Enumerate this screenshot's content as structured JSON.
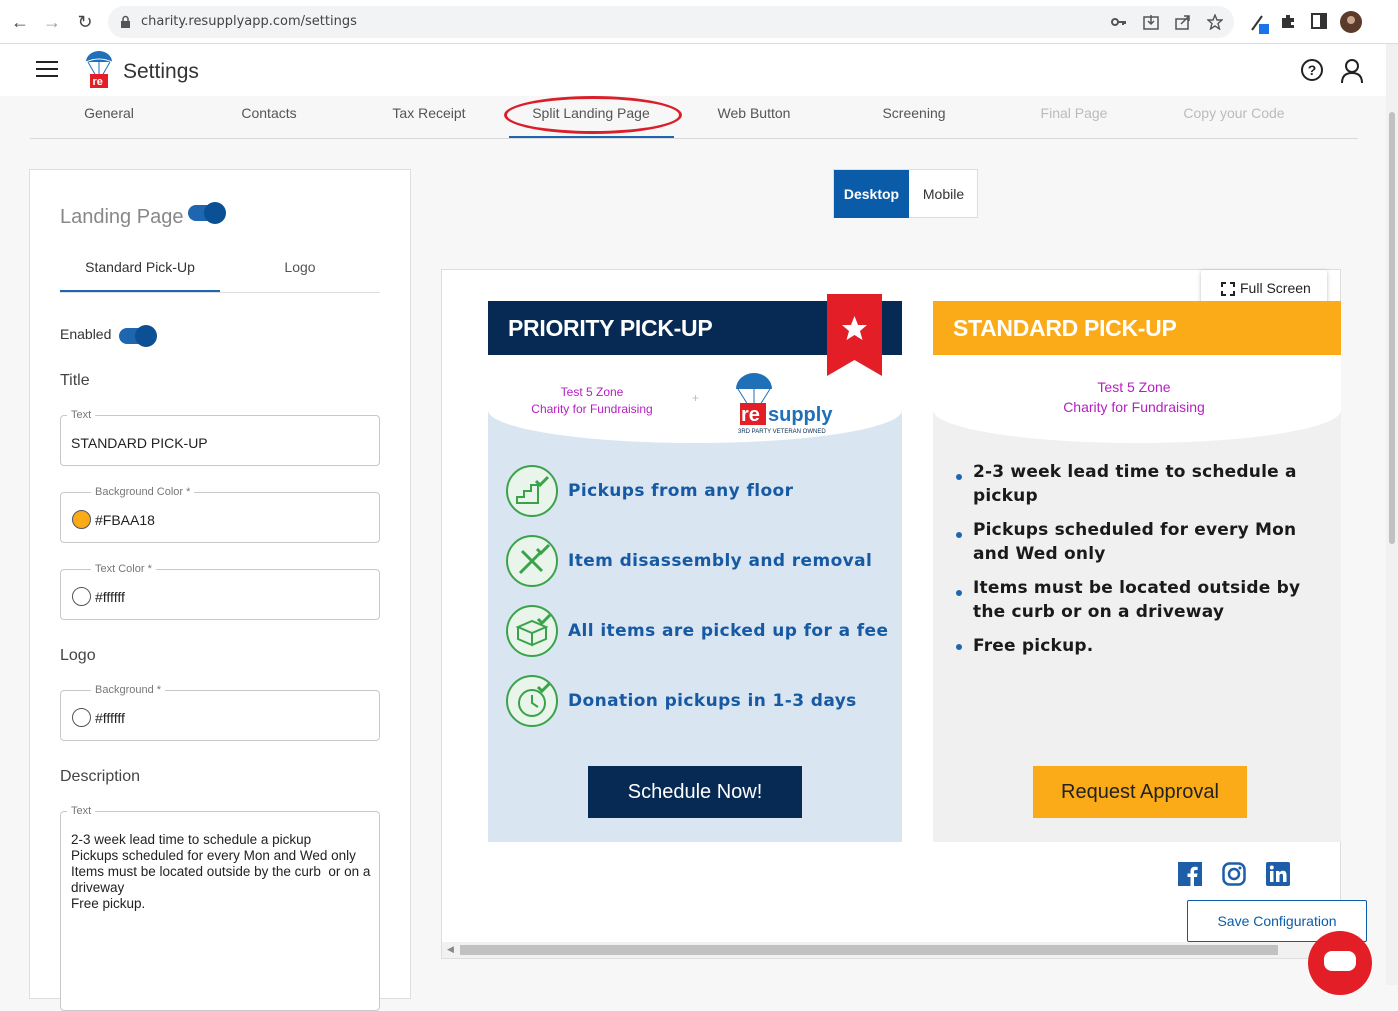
{
  "browser": {
    "url": "charity.resupplyapp.com/settings"
  },
  "header": {
    "title": "Settings",
    "help": "?"
  },
  "tabs": [
    {
      "label": "General"
    },
    {
      "label": "Contacts"
    },
    {
      "label": "Tax Receipt"
    },
    {
      "label": "Split Landing Page"
    },
    {
      "label": "Web Button"
    },
    {
      "label": "Screening"
    },
    {
      "label": "Final Page"
    },
    {
      "label": "Copy your Code"
    }
  ],
  "left_panel": {
    "heading": "Landing Page",
    "subtabs": [
      "Standard Pick-Up",
      "Logo"
    ],
    "enabled_label": "Enabled",
    "title_section": "Title",
    "title_field": {
      "label": "Text",
      "value": "STANDARD PICK-UP"
    },
    "bg_color_field": {
      "label": "Background Color *",
      "value": "#FBAA18"
    },
    "text_color_field": {
      "label": "Text Color *",
      "value": "#ffffff"
    },
    "logo_section": "Logo",
    "logo_bg_field": {
      "label": "Background *",
      "value": "#ffffff"
    },
    "description_section": "Description",
    "description_field": {
      "label": "Text",
      "value": "2-3 week lead time to schedule a pickup\nPickups scheduled for every Mon and Wed only\nItems must be located outside by the curb  or on a driveway\nFree pickup."
    }
  },
  "preview": {
    "segment": {
      "desktop": "Desktop",
      "mobile": "Mobile"
    },
    "fullscreen": "Full Screen",
    "priority": {
      "title": "PRIORITY PICK-UP",
      "charity_line1": "Test 5 Zone",
      "charity_line2": "Charity for Fundraising",
      "plus": "+",
      "resupply_tagline": "3RD PARTY VETERAN OWNED",
      "features": [
        "Pickups from any floor",
        "Item disassembly and removal",
        "All items are picked up for a fee",
        "Donation pickups in 1-3 days"
      ],
      "cta": "Schedule Now!"
    },
    "standard": {
      "title": "STANDARD PICK-UP",
      "charity_line1": "Test 5 Zone",
      "charity_line2": "Charity for Fundraising",
      "bullets": [
        "2-3 week lead time to schedule a pickup",
        "Pickups scheduled for every Mon and Wed only",
        "Items must be located outside by the curb or on a driveway",
        "Free pickup."
      ],
      "cta": "Request Approval"
    }
  },
  "save_button": "Save Configuration",
  "colors": {
    "brand_blue": "#0b5ca8",
    "priority_header": "#062a54",
    "standard_header": "#FBAA18",
    "ribbon": "#e41e26"
  }
}
